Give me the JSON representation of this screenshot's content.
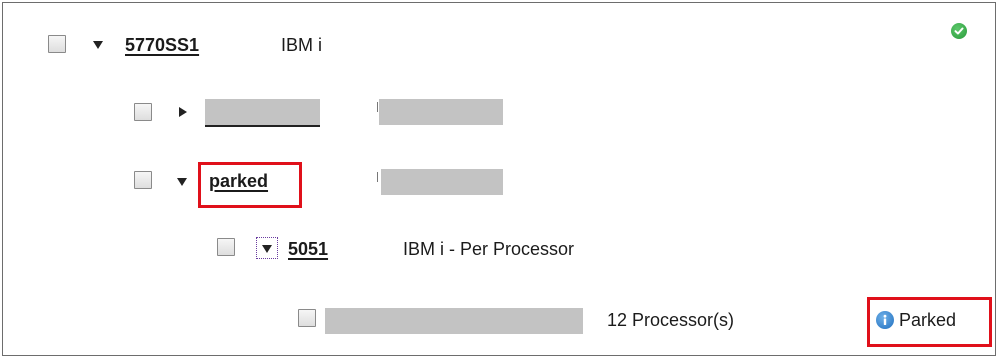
{
  "tree": {
    "root": {
      "name": "5770SS1",
      "description": "IBM i",
      "expanded": true,
      "status_icon": "checkmark-circle-icon"
    },
    "child_hidden": {
      "expanded": false
    },
    "parked_group": {
      "name": "parked",
      "expanded": true
    },
    "feature": {
      "name": "5051",
      "description": "IBM i - Per Processor",
      "expanded": true
    },
    "license_row": {
      "quantity": "12 Processor(s)",
      "status_icon": "info-icon",
      "status": "Parked"
    }
  },
  "colors": {
    "highlight": "#e0101a",
    "ok_green": "#2a9a3c",
    "info_blue": "#1f6fbf",
    "redacted": "#c3c3c3"
  }
}
